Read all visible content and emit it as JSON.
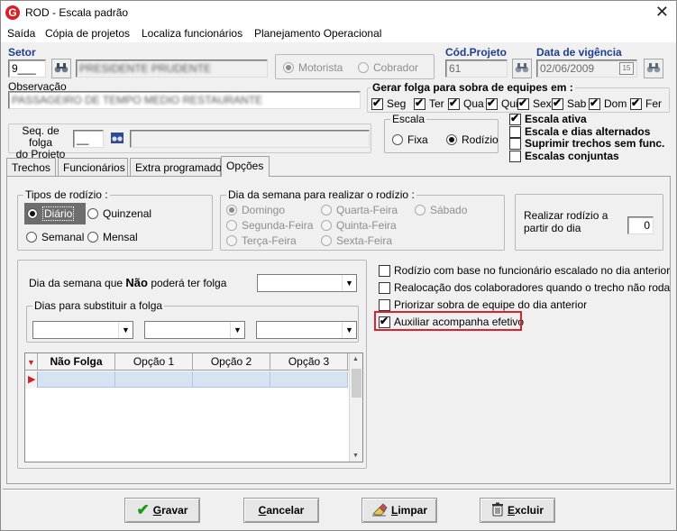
{
  "window": {
    "title": "ROD - Escala padrão",
    "app_icon": "G",
    "close_glyph": "✕"
  },
  "menu": [
    "Saída",
    "Cópia de projetos",
    "Localiza funcionários",
    "Planejamento Operacional"
  ],
  "setor": {
    "label": "Setor",
    "code": "9___",
    "name": "PRESIDENTE PRUDENTE"
  },
  "radios_top": {
    "motorista": "Motorista",
    "cobrador": "Cobrador",
    "selected": "motorista"
  },
  "cod_projeto": {
    "label": "Cód.Projeto",
    "value": "61"
  },
  "data_vigencia": {
    "label": "Data de vigência",
    "value": "02/06/2009",
    "cal_glyph": "15"
  },
  "observacao": {
    "label": "Observação",
    "value": "PASSAGEIRO DE TEMPO MEDIO RESTAURANTE"
  },
  "gerar_folga": {
    "title": "Gerar folga para sobra de equipes em :",
    "days": [
      {
        "label": "Seg",
        "checked": true
      },
      {
        "label": "Ter",
        "checked": true
      },
      {
        "label": "Qua",
        "checked": true
      },
      {
        "label": "Qui",
        "checked": true
      },
      {
        "label": "Sex",
        "checked": true
      },
      {
        "label": "Sab",
        "checked": true
      },
      {
        "label": "Dom",
        "checked": true
      },
      {
        "label": "Fer",
        "checked": true
      }
    ]
  },
  "seq_folga": {
    "label_line1": "Seq. de folga",
    "label_line2": "do Projeto",
    "value": "__"
  },
  "escala": {
    "title": "Escala",
    "fixa": "Fixa",
    "rodizio": "Rodízio",
    "selected": "rodizio"
  },
  "escala_checks": [
    {
      "label": "Escala ativa",
      "checked": true
    },
    {
      "label": "Escala e dias alternados",
      "checked": false
    },
    {
      "label": "Suprimir trechos sem func.",
      "checked": false
    },
    {
      "label": "Escalas conjuntas",
      "checked": false
    }
  ],
  "tabs": [
    {
      "label": "Trechos",
      "active": false
    },
    {
      "label": "Funcionários",
      "active": false
    },
    {
      "label": "Extra programado",
      "active": false
    },
    {
      "label": "Opções",
      "active": true
    }
  ],
  "tipos_rodizio": {
    "title": "Tipos de rodízio :",
    "options": [
      "Diário",
      "Quinzenal",
      "Semanal",
      "Mensal"
    ],
    "selected": "Diário"
  },
  "dia_semana_rodizio": {
    "title": "Dia da semana para realizar o rodízio :",
    "options": [
      "Domingo",
      "Quarta-Feira",
      "Sábado",
      "Segunda-Feira",
      "Quinta-Feira",
      "Terça-Feira",
      "Sexta-Feira"
    ],
    "selected": "Domingo"
  },
  "realizar_rodizio": {
    "line1": "Realizar rodízio a",
    "line2": "partir do dia",
    "value": "0"
  },
  "dia_sem_folga": {
    "prefix": "Dia da semana que",
    "bold": "Não",
    "suffix": "poderá ter folga"
  },
  "dias_substituir": {
    "title": "Dias para substituir a folga"
  },
  "grid": {
    "columns": [
      "Não Folga",
      "Opção 1",
      "Opção 2",
      "Opção 3"
    ]
  },
  "options_checks": [
    {
      "label": "Rodízio com base no funcionário escalado no dia anterior",
      "checked": false
    },
    {
      "label": "Realocação dos colaboradores quando o trecho não roda",
      "checked": false
    },
    {
      "label": "Priorizar sobra de equipe do dia anterior",
      "checked": false
    },
    {
      "label": "Auxiliar acompanha efetivo",
      "checked": true
    }
  ],
  "buttons": {
    "gravar": {
      "underline": "G",
      "rest": "ravar"
    },
    "cancelar": {
      "underline": "C",
      "rest": "ancelar"
    },
    "limpar": {
      "underline": "L",
      "rest": "impar"
    },
    "excluir": {
      "underline": "E",
      "rest": "xcluir"
    }
  },
  "colors": {
    "accent_label": "#1c3f8c",
    "highlight": "#e0202a",
    "grid_row": "#d5e3f3"
  }
}
